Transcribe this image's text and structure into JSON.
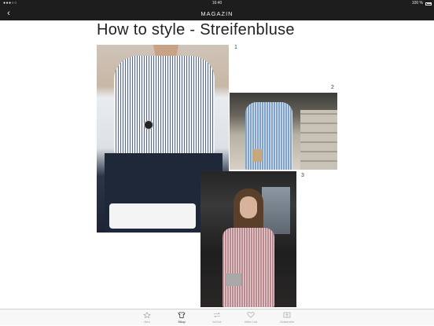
{
  "statusbar": {
    "signal": "●●●○○",
    "time": "16:40",
    "battery": "100 %"
  },
  "navbar": {
    "back": "‹",
    "title": "MAGAZIN"
  },
  "article": {
    "title": "How to style - Streifenbluse",
    "photos": [
      {
        "number": "1"
      },
      {
        "number": "2"
      },
      {
        "number": "3"
      }
    ]
  },
  "tabbar": {
    "tabs": [
      {
        "label": "Neu",
        "icon": "star-icon"
      },
      {
        "label": "Shop",
        "icon": "shirt-icon"
      },
      {
        "label": "In/Out",
        "icon": "swap-icon"
      },
      {
        "label": "Wish List",
        "icon": "heart-icon"
      },
      {
        "label": "Gutschein",
        "icon": "voucher-icon"
      }
    ],
    "active": "Shop"
  }
}
